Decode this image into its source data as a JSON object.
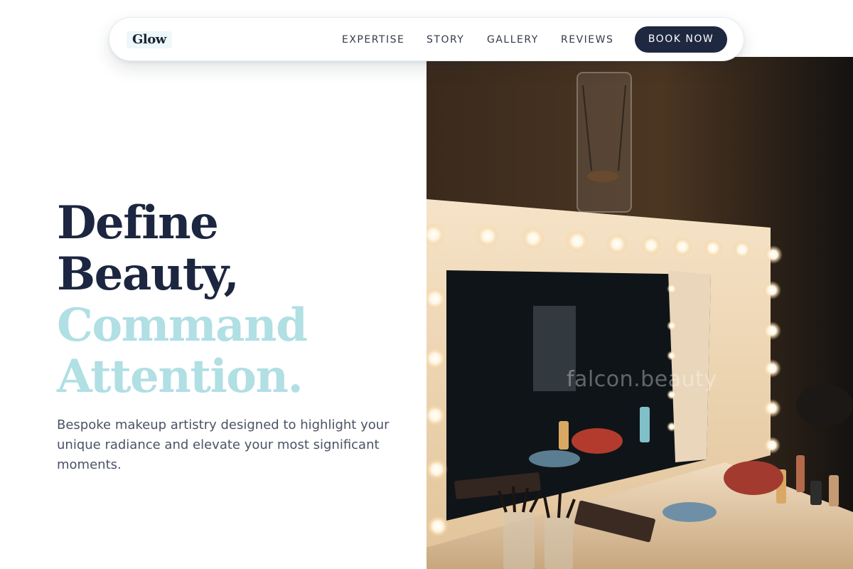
{
  "nav": {
    "logo": "Glow",
    "links": [
      "EXPERTISE",
      "STORY",
      "GALLERY",
      "REVIEWS"
    ],
    "cta": "BOOK NOW"
  },
  "hero": {
    "title_line1": "Define",
    "title_line2": "Beauty,",
    "title_line3": "Command",
    "title_line4": "Attention.",
    "subtitle": "Bespoke makeup artistry designed to highlight your unique radiance and elevate your most significant moments."
  },
  "photo": {
    "watermark": "falcon.beauty",
    "subject": "vanity mirror with light bulbs and makeup table"
  },
  "colors": {
    "navy": "#1c2640",
    "accent_light_blue": "#b0dfe4",
    "body_text": "#4a5365",
    "cta_bg": "#1e2840"
  }
}
